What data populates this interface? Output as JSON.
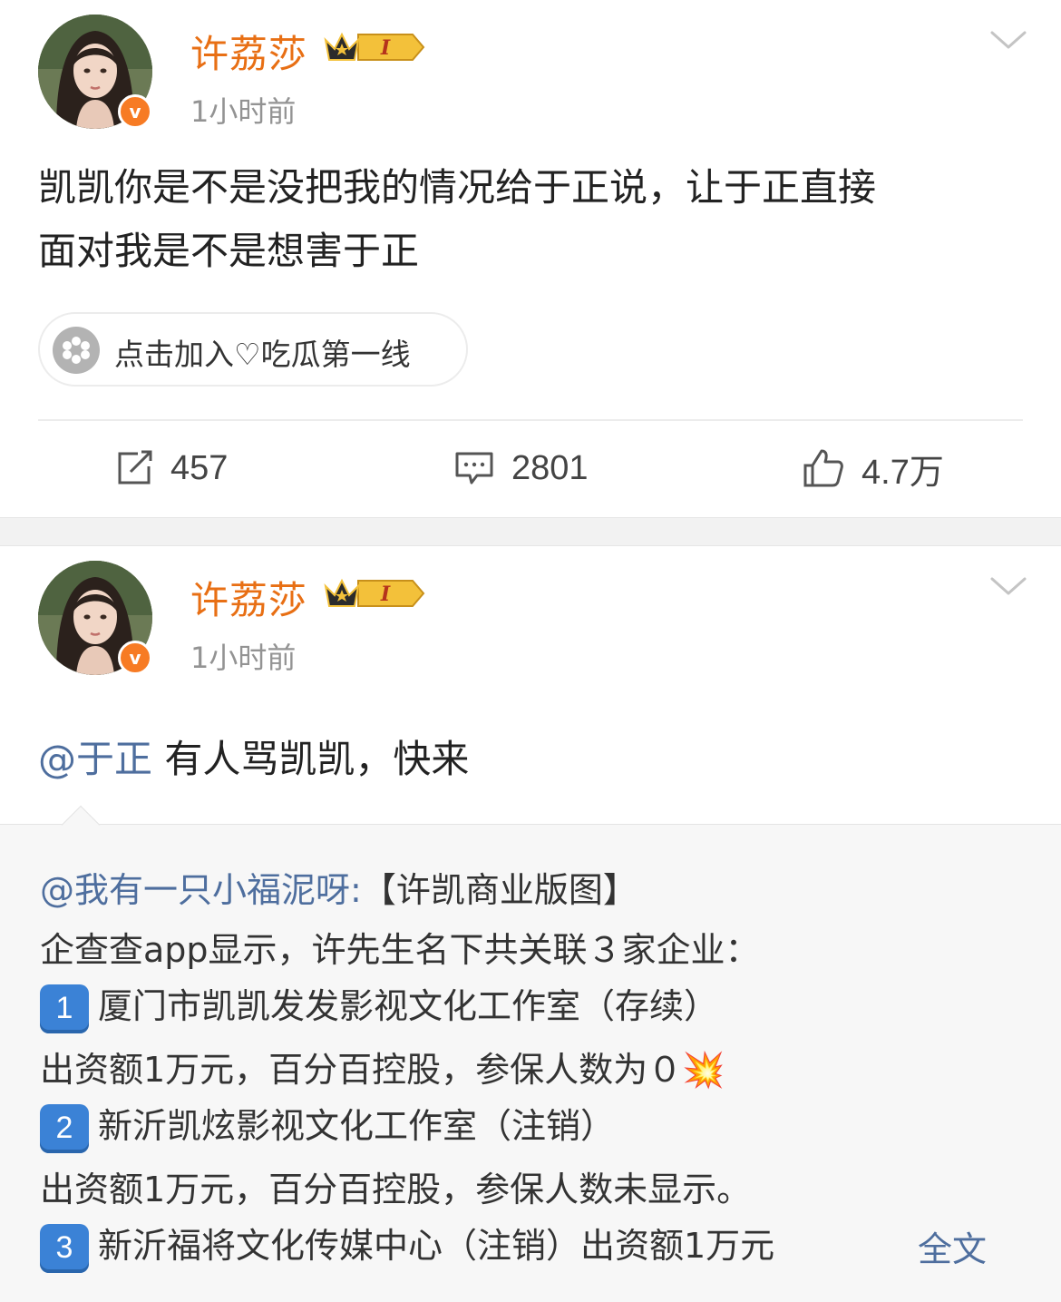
{
  "posts": [
    {
      "username": "许荔莎",
      "badge_level": "I",
      "time": "1小时前",
      "content_lines": [
        "凯凯你是不是没把我的情况给于正说，让于正直接",
        "面对我是不是想害于正"
      ],
      "group_link": "点击加入♡吃瓜第一线",
      "stats": {
        "reposts": "457",
        "comments": "2801",
        "likes": "4.7万"
      }
    },
    {
      "username": "许荔莎",
      "badge_level": "I",
      "time": "1小时前",
      "mention": "@于正",
      "content": " 有人骂凯凯，快来",
      "retweet": {
        "author": "@我有一只小福泥呀:",
        "title": "【许凯商业版图】",
        "line1": "企查查app显示，许先生名下共关联３家企业：",
        "item1_num": "1",
        "item1": "厦门市凯凯发发影视文化工作室（存续）",
        "item1_detail": "出资额1万元，百分百控股，参保人数为０💥",
        "item2_num": "2",
        "item2": "新沂凯炫影视文化工作室（注销）",
        "item2_detail": "出资额1万元，百分百控股，参保人数未显示。",
        "item3_num": "3",
        "item3": "新沂福将文化传媒中心（注销）出资额1万元",
        "fulltext": "全文"
      }
    }
  ],
  "icons": {
    "more": "chevron-down-icon",
    "repost": "repost-icon",
    "comment": "comment-icon",
    "like": "thumbs-up-icon",
    "verified": "verified-v-icon"
  },
  "colors": {
    "username": "#e86f14",
    "link": "#4e6e9e",
    "verified": "#f77b24"
  }
}
